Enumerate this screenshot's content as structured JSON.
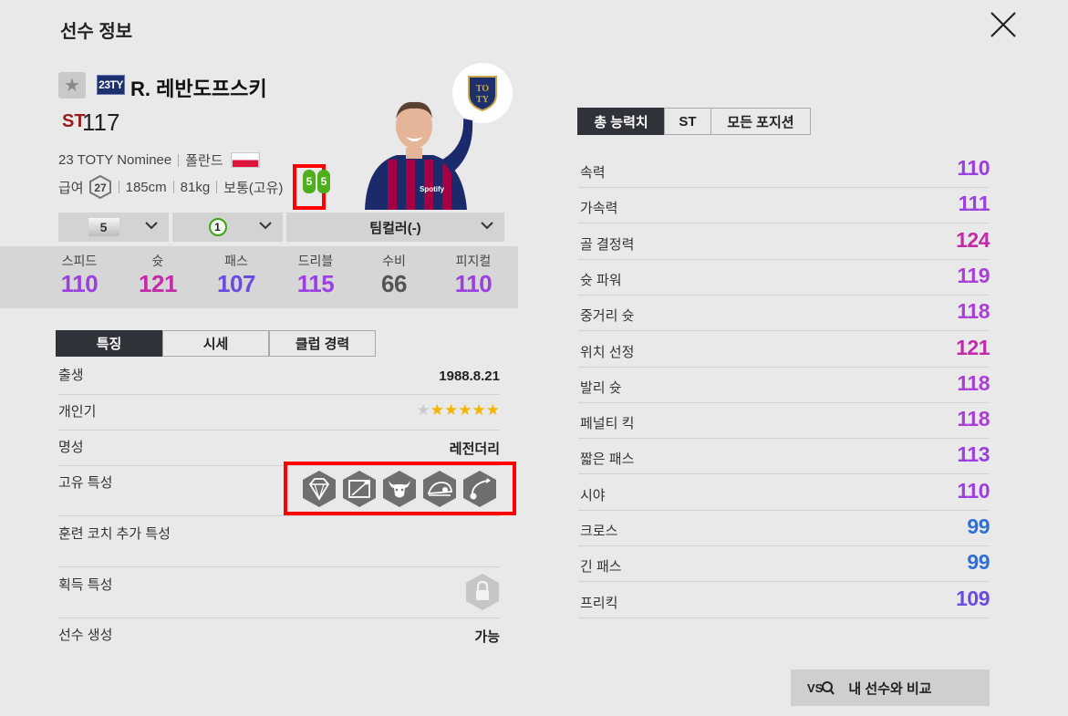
{
  "header": {
    "title": "선수 정보"
  },
  "player": {
    "season_badge": "23TY",
    "name": "R. 레반도프스키",
    "position": "ST",
    "overall": "117",
    "card_name": "23 TOTY Nominee",
    "nation": "폴란드",
    "salary_label": "급여",
    "salary": "27",
    "height": "185cm",
    "weight": "81kg",
    "body_type": "보통(고유)",
    "foot_left": "5",
    "foot_right": "5"
  },
  "dropdowns": {
    "grade": "5",
    "level": "1",
    "team_color": "팀컬러(-)"
  },
  "summary_stats": [
    {
      "label": "스피드",
      "value": "110",
      "color": "#9b3fe0"
    },
    {
      "label": "슛",
      "value": "121",
      "color": "#c22aa8"
    },
    {
      "label": "패스",
      "value": "107",
      "color": "#6b4ae0"
    },
    {
      "label": "드리블",
      "value": "115",
      "color": "#9b3fe0"
    },
    {
      "label": "수비",
      "value": "66",
      "color": "#555555"
    },
    {
      "label": "피지컬",
      "value": "110",
      "color": "#9b3fe0"
    }
  ],
  "tabs": [
    "특징",
    "시세",
    "클럽 경력"
  ],
  "features": {
    "birth_label": "출생",
    "birth": "1988.8.21",
    "skill_label": "개인기",
    "skill_stars": 5,
    "reputation_label": "명성",
    "reputation": "레전더리",
    "traits_label": "고유 특성",
    "traits": [
      "diamond-icon",
      "goal-net-icon",
      "bull-icon",
      "speed-dribble-icon",
      "curl-shot-icon"
    ],
    "coach_traits_label": "훈련 코치 추가 특성",
    "acquired_traits_label": "획득 특성",
    "creatable_label": "선수 생성",
    "creatable": "가능"
  },
  "ability_tabs": [
    "총 능력치",
    "ST",
    "모든 포지션"
  ],
  "abilities": [
    {
      "name": "속력",
      "value": "110",
      "color": "#9b3fe0"
    },
    {
      "name": "가속력",
      "value": "111",
      "color": "#9b3fe0"
    },
    {
      "name": "골 결정력",
      "value": "124",
      "color": "#c22aa8"
    },
    {
      "name": "슛 파워",
      "value": "119",
      "color": "#a93fd6"
    },
    {
      "name": "중거리 슛",
      "value": "118",
      "color": "#a93fd6"
    },
    {
      "name": "위치 선정",
      "value": "121",
      "color": "#c22aa8"
    },
    {
      "name": "발리 슛",
      "value": "118",
      "color": "#a93fd6"
    },
    {
      "name": "페널티 킥",
      "value": "118",
      "color": "#a93fd6"
    },
    {
      "name": "짧은 패스",
      "value": "113",
      "color": "#9b3fe0"
    },
    {
      "name": "시야",
      "value": "110",
      "color": "#9b3fe0"
    },
    {
      "name": "크로스",
      "value": "99",
      "color": "#2f6fd6"
    },
    {
      "name": "긴 패스",
      "value": "99",
      "color": "#2f6fd6"
    },
    {
      "name": "프리킥",
      "value": "109",
      "color": "#6b4ae0"
    }
  ],
  "compare_button": "내 선수와 비교"
}
